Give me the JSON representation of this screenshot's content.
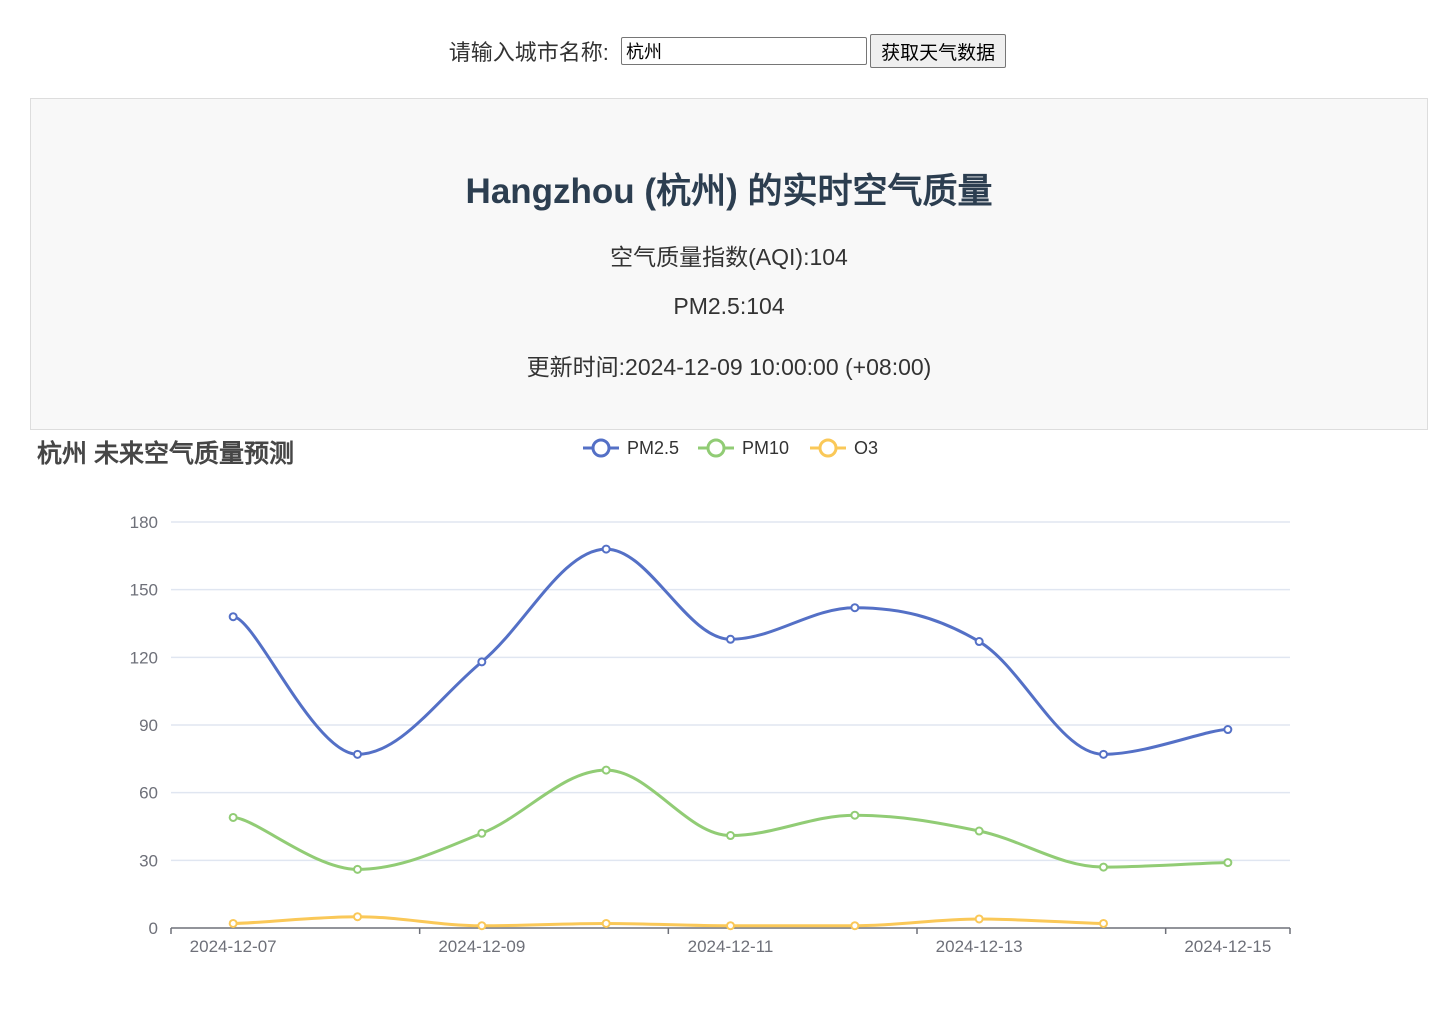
{
  "search": {
    "label": "请输入城市名称:",
    "input_value": "杭州",
    "button_label": "获取天气数据"
  },
  "panel": {
    "title": "Hangzhou (杭州) 的实时空气质量",
    "aqi_text": "空气质量指数(AQI):104",
    "pm25_text": "PM2.5:104",
    "update_text": "更新时间:2024-12-09 10:00:00 (+08:00)"
  },
  "chart_data": {
    "type": "line",
    "title": "杭州 未来空气质量预测",
    "x": [
      "2024-12-07",
      "2024-12-08",
      "2024-12-09",
      "2024-12-10",
      "2024-12-11",
      "2024-12-12",
      "2024-12-13",
      "2024-12-14",
      "2024-12-15"
    ],
    "x_tick_labels": [
      "2024-12-07",
      "2024-12-09",
      "2024-12-11",
      "2024-12-13",
      "2024-12-15"
    ],
    "ylim": [
      0,
      180
    ],
    "y_ticks": [
      0,
      30,
      60,
      90,
      120,
      150,
      180
    ],
    "grid": true,
    "legend_position": "top-center",
    "series": [
      {
        "name": "PM2.5",
        "color": "#5470c6",
        "values": [
          138,
          77,
          118,
          168,
          128,
          142,
          127,
          77,
          88
        ]
      },
      {
        "name": "PM10",
        "color": "#91cc75",
        "values": [
          49,
          26,
          42,
          70,
          41,
          50,
          43,
          27,
          29
        ]
      },
      {
        "name": "O3",
        "color": "#fac858",
        "values": [
          2,
          5,
          1,
          2,
          1,
          1,
          4,
          2,
          null
        ]
      }
    ]
  }
}
